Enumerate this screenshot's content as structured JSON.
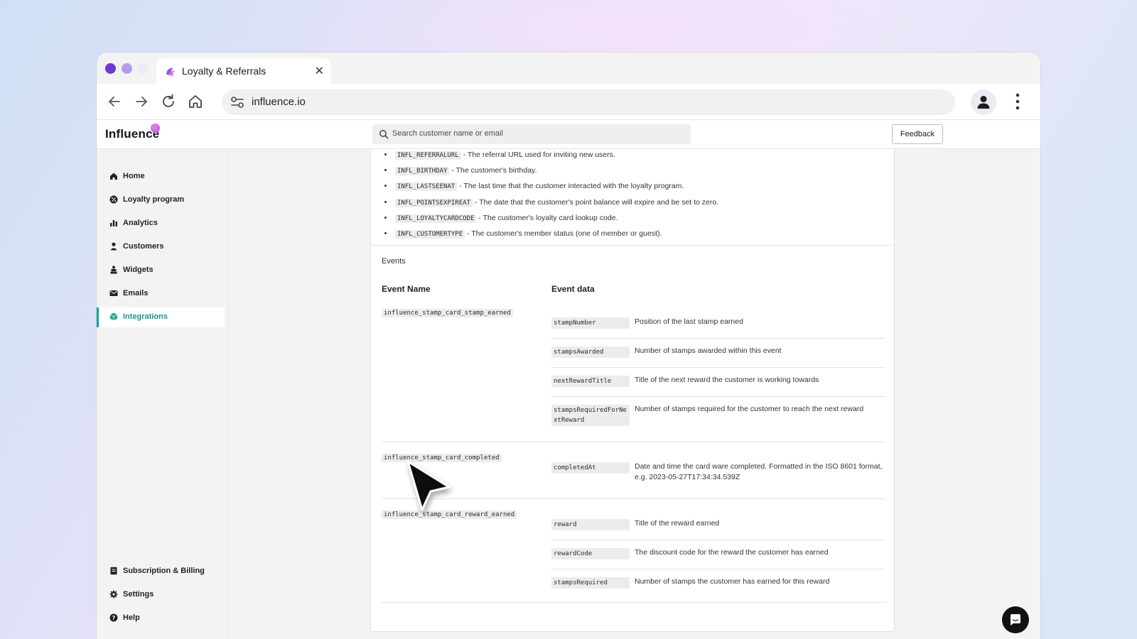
{
  "browser": {
    "tab_title": "Loyalty & Referrals",
    "url": "influence.io"
  },
  "app": {
    "brand": "Influence",
    "search_placeholder": "Search customer name or email",
    "feedback_label": "Feedback",
    "accent_color": "#14a39a"
  },
  "sidebar": {
    "items": [
      {
        "label": "Home",
        "icon": "home-icon"
      },
      {
        "label": "Loyalty program",
        "icon": "loyalty-icon"
      },
      {
        "label": "Analytics",
        "icon": "analytics-icon"
      },
      {
        "label": "Customers",
        "icon": "person-icon"
      },
      {
        "label": "Widgets",
        "icon": "widgets-icon"
      },
      {
        "label": "Emails",
        "icon": "mail-icon"
      },
      {
        "label": "Integrations",
        "icon": "cube-icon",
        "active": true
      }
    ],
    "bottom_items": [
      {
        "label": "Subscription & Billing",
        "icon": "billing-icon"
      },
      {
        "label": "Settings",
        "icon": "gear-icon"
      },
      {
        "label": "Help",
        "icon": "help-icon"
      }
    ]
  },
  "attributes": [
    {
      "code": "INFL_REFERRALURL",
      "text": " - The referral URL used for inviting new users."
    },
    {
      "code": "INFL_BIRTHDAY",
      "text": " - The customer's birthday."
    },
    {
      "code": "INFL_LASTSEENAT",
      "text": " - The last time that the customer interacted with the loyalty program."
    },
    {
      "code": "INFL_POINTSEXPIREAT",
      "text": " - The date that the customer's point balance will expire and be set to zero."
    },
    {
      "code": "INFL_LOYALTYCARDCODE",
      "text": " - The customer's loyalty card lookup code."
    },
    {
      "code": "INFL_CUSTOMERTYPE",
      "text": " - The customer's member status (one of member or guest)."
    }
  ],
  "events": {
    "section_label": "Events",
    "col_event_name": "Event Name",
    "col_event_data": "Event data",
    "list": [
      {
        "name": "influence_stamp_card_stamp_earned",
        "data": [
          {
            "key": "stampNumber",
            "desc": "Position of the last stamp earned"
          },
          {
            "key": "stampsAwarded",
            "desc": "Number of stamps awarded within this event"
          },
          {
            "key": "nextRewardTitle",
            "desc": "Title of the next reward the customer is working towards"
          },
          {
            "key": "stampsRequiredForNextReward",
            "desc": "Number of stamps required for the customer to reach the next reward"
          }
        ]
      },
      {
        "name": "influence_stamp_card_completed",
        "data": [
          {
            "key": "completedAt",
            "desc": "Date and time the card ware completed. Formatted in the ISO 8601 format, e.g. 2023-05-27T17:34:34.539Z"
          }
        ]
      },
      {
        "name": "influence_stamp_card_reward_earned",
        "data": [
          {
            "key": "reward",
            "desc": "Title of the reward earned"
          },
          {
            "key": "rewardCode",
            "desc": "The discount code for the reward the customer has earned"
          },
          {
            "key": "stampsRequired",
            "desc": "Number of stamps the customer has earned for this reward"
          }
        ]
      }
    ]
  }
}
